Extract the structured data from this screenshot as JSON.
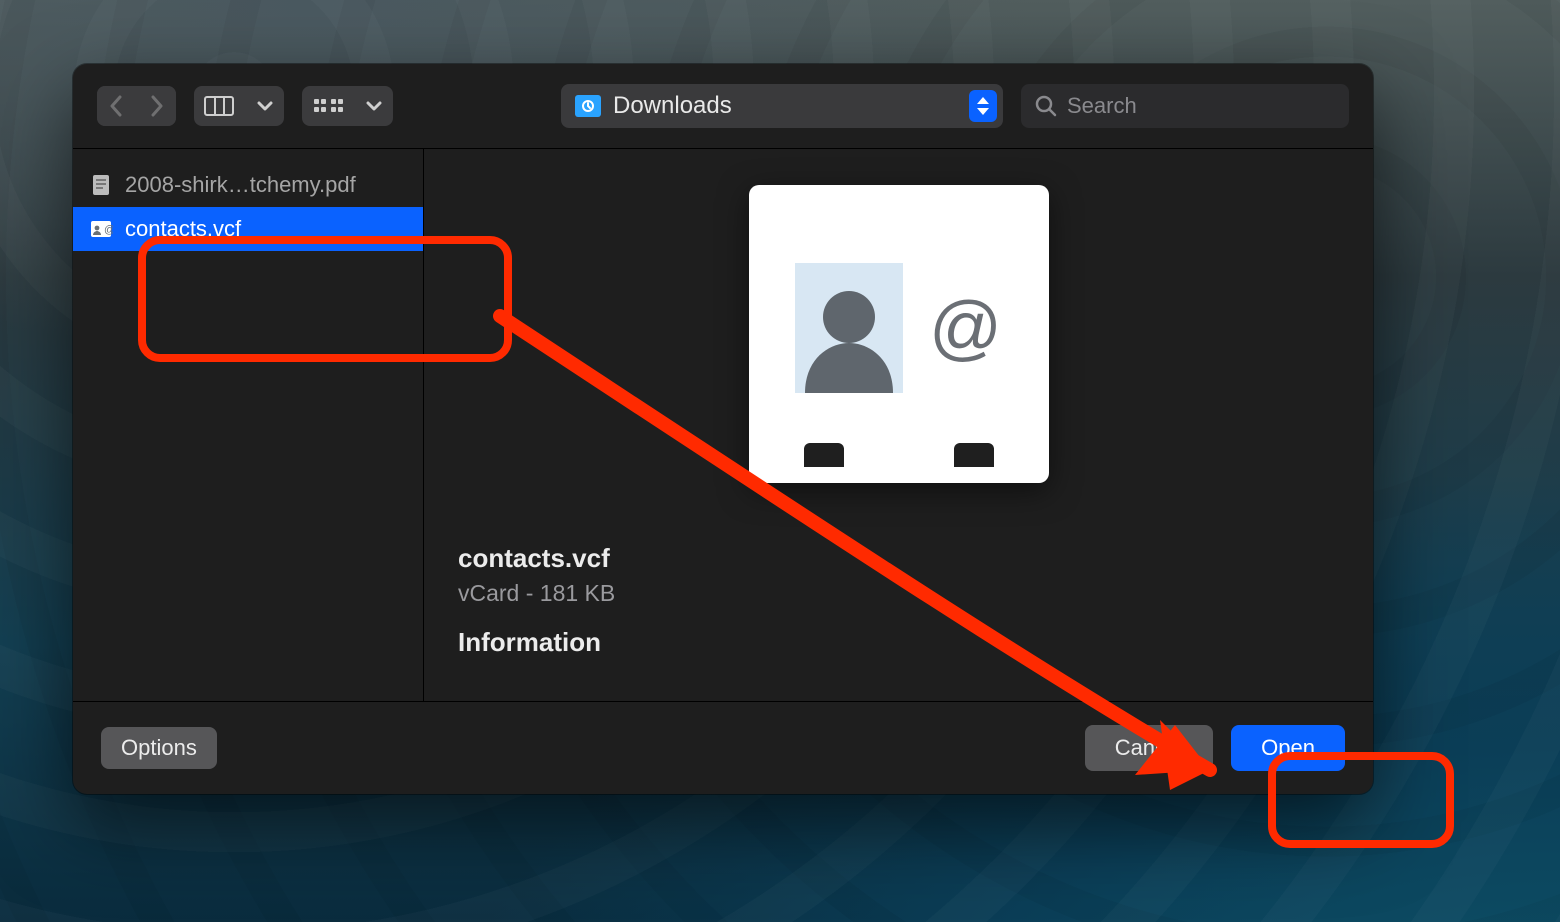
{
  "location": {
    "folder": "Downloads"
  },
  "search": {
    "placeholder": "Search"
  },
  "files": [
    {
      "name": "2008-shirk…tchemy.pdf",
      "selected": false,
      "icon": "pdf"
    },
    {
      "name": "contacts.vcf",
      "selected": true,
      "icon": "vcard"
    }
  ],
  "preview": {
    "filename": "contacts.vcf",
    "kind_and_size": "vCard - 181 KB",
    "info_header": "Information"
  },
  "footer": {
    "options_label": "Options",
    "cancel_label": "Cancel",
    "open_label": "Open"
  }
}
